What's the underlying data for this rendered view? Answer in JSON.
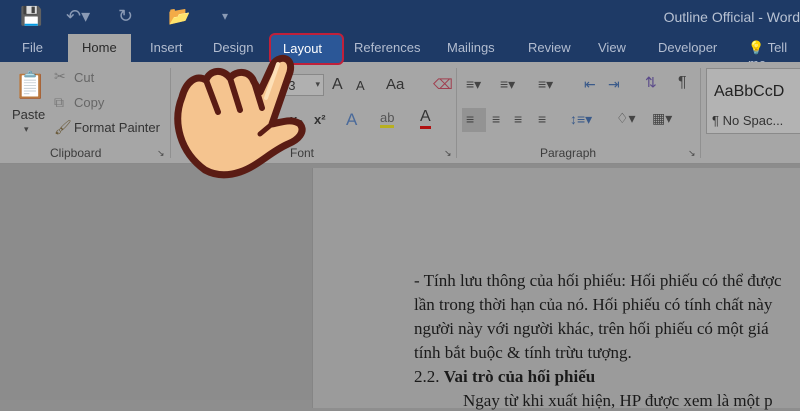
{
  "window": {
    "title": "Outline Official - Word"
  },
  "tabs": [
    "File",
    "Home",
    "Insert",
    "Design",
    "Layout",
    "References",
    "Mailings",
    "Review",
    "View",
    "Developer"
  ],
  "tell_me": "Tell me",
  "clipboard": {
    "paste": "Paste",
    "cut": "Cut",
    "copy": "Copy",
    "format_painter": "Format Painter",
    "group": "Clipboard"
  },
  "font": {
    "size": "13",
    "group": "Font",
    "grow": "A",
    "shrink": "A",
    "case": "Aa",
    "subscript": "x₂",
    "superscript": "x²"
  },
  "paragraph": {
    "group": "Paragraph"
  },
  "styles": {
    "preview": "AaBbCcD",
    "name": "¶ No Spac..."
  },
  "document": {
    "lines": [
      "- Tính lưu thông của hối phiếu: Hối phiếu có thể được",
      "lần trong thời hạn của nó. Hối phiếu có tính chất này",
      "người này với người khác, trên hối phiếu có một giá",
      "tính bắt buộc & tính trừu tượng."
    ],
    "heading_number": "2.2.",
    "heading": "Vai trò của hối phiếu",
    "partial_line": "Ngay từ khi xuất hiện, HP được xem là một p"
  }
}
